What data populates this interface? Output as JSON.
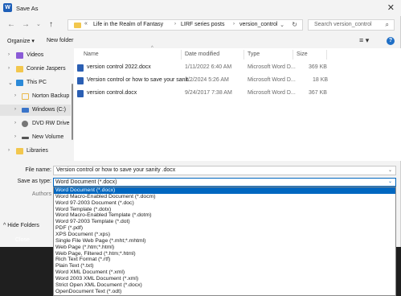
{
  "window": {
    "title": "Save As",
    "app_icon": "W"
  },
  "address": {
    "crumbs": [
      "Life in the Realm of Fantasy",
      "LIRF series posts",
      "version_control"
    ],
    "chevron": "«"
  },
  "search": {
    "placeholder": "Search version_control"
  },
  "toolbar": {
    "organize": "Organize ▾",
    "new_folder": "New folder"
  },
  "nav_pane": {
    "items": [
      {
        "label": "Videos",
        "icon": "videos-folder",
        "color": "#8a5bd6"
      },
      {
        "label": "Connie Jaspers",
        "icon": "folder",
        "color": "#f2c74e"
      },
      {
        "label": "This PC",
        "icon": "monitor",
        "color": "#2c8ad8"
      },
      {
        "label": "Norton Backup",
        "icon": "folder-outline",
        "color": "#e9b84a"
      },
      {
        "label": "Windows (C:)",
        "icon": "drive",
        "color": "#3a74c9"
      },
      {
        "label": "DVD RW Drive",
        "icon": "dvd-drive",
        "color": "#777777"
      },
      {
        "label": "New Volume",
        "icon": "drive",
        "color": "#555555"
      },
      {
        "label": "Libraries",
        "icon": "folder",
        "color": "#f2c74e"
      }
    ]
  },
  "file_list": {
    "columns": [
      "Name",
      "Date modified",
      "Type",
      "Size"
    ],
    "rows": [
      {
        "name": "version control 2022.docx",
        "date": "1/11/2022 6:40 AM",
        "type": "Microsoft Word D...",
        "size": "369 KB"
      },
      {
        "name": "Version control or how to save your sanit...",
        "date": "1/2/2024 5:26 AM",
        "type": "Microsoft Word D...",
        "size": "18 KB"
      },
      {
        "name": "version control.docx",
        "date": "9/24/2017 7:38 AM",
        "type": "Microsoft Word D...",
        "size": "367 KB"
      }
    ]
  },
  "form": {
    "file_name_label": "File name:",
    "file_name_value": "Version control or how to save your sanity .docx",
    "save_type_label": "Save as type:",
    "save_type_value": "Word Document (*.docx)",
    "authors_label": "Authors",
    "hide_folders": "Hide Folders"
  },
  "type_options": [
    "Word Document (*.docx)",
    "Word Macro-Enabled Document (*.docm)",
    "Word 97-2003 Document (*.doc)",
    "Word Template (*.dotx)",
    "Word Macro-Enabled Template (*.dotm)",
    "Word 97-2003 Template (*.dot)",
    "PDF (*.pdf)",
    "XPS Document (*.xps)",
    "Single File Web Page (*.mht;*.mhtml)",
    "Web Page (*.htm;*.html)",
    "Web Page, Filtered (*.htm;*.html)",
    "Rich Text Format (*.rtf)",
    "Plain Text (*.txt)",
    "Word XML Document (*.xml)",
    "Word 2003 XML Document (*.xml)",
    "Strict Open XML Document (*.docx)",
    "OpenDocument Text (*.odt)"
  ],
  "background_app": {
    "close_label": "Close"
  }
}
